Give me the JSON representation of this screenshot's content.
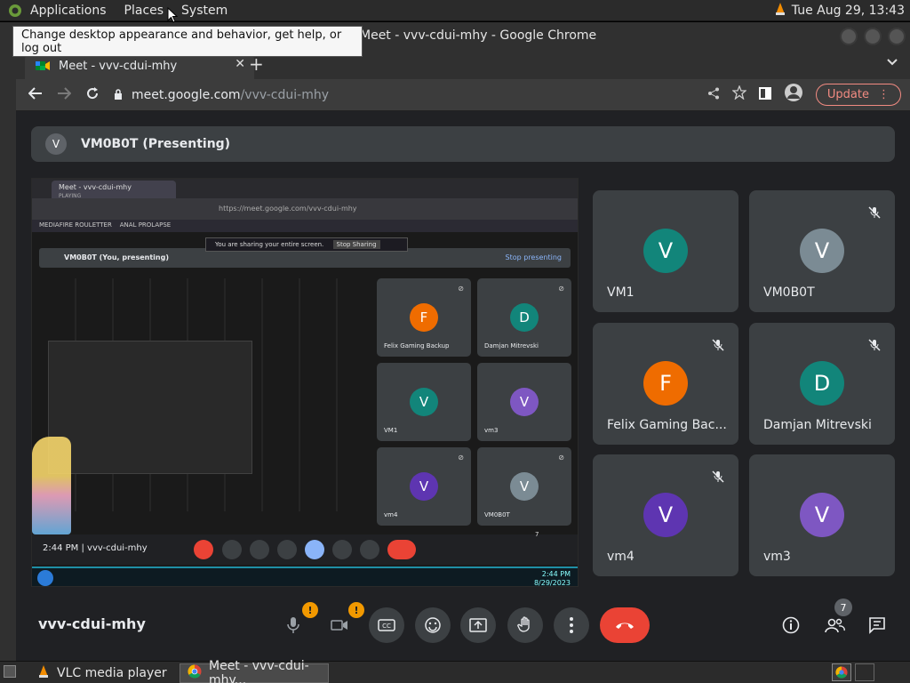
{
  "top_panel": {
    "menus": [
      "Applications",
      "Places",
      "System"
    ],
    "datetime": "Tue Aug 29, 13:43"
  },
  "tooltip": "Change desktop appearance and behavior, get help, or log out",
  "window": {
    "title": "Meet - vvv-cdui-mhy - Google Chrome"
  },
  "browser": {
    "tab_title": "Meet - vvv-cdui-mhy",
    "url_host": "meet.google.com",
    "url_path": "/vvv-cdui-mhy",
    "update_label": "Update"
  },
  "meet": {
    "presenting_initial": "V",
    "presenting_label": "VM0B0T (Presenting)",
    "meeting_code": "vvv-cdui-mhy",
    "people_count": "7",
    "mic_badge": "!",
    "cam_badge": "!",
    "participants": [
      {
        "initial": "V",
        "name": "VM1",
        "color": "#12857a",
        "muted": false
      },
      {
        "initial": "V",
        "name": "VM0B0T",
        "color": "#7b8b94",
        "muted": true
      },
      {
        "initial": "F",
        "name": "Felix Gaming Bac...",
        "color": "#ef6c00",
        "muted": true
      },
      {
        "initial": "D",
        "name": "Damjan Mitrevski",
        "color": "#12857a",
        "muted": true
      },
      {
        "initial": "V",
        "name": "vm4",
        "color": "#5e35b1",
        "muted": true
      },
      {
        "initial": "V",
        "name": "vm3",
        "color": "#7e57c2",
        "muted": false
      }
    ]
  },
  "screenshare": {
    "tab_title": "Meet - vvv-cdui-mhy",
    "tab_subtitle": "PLAYING",
    "url": "https://meet.google.com/vvv-cdui-mhy",
    "bookmark1": "MEDIAFIRE ROULETTER",
    "bookmark2": "ANAL PROLAPSE",
    "share_notice": "You are sharing your entire screen.",
    "stop_sharing": "Stop Sharing",
    "present_label": "VM0B0T (You, presenting)",
    "stop_presenting": "Stop presenting",
    "time_code": "2:44 PM  |  vvv-cdui-mhy",
    "tb_time": "2:44 PM",
    "tb_date": "8/29/2023",
    "tiles": [
      {
        "initial": "F",
        "name": "Felix Gaming Backup",
        "color": "#ef6c00"
      },
      {
        "initial": "D",
        "name": "Damjan Mitrevski",
        "color": "#12857a"
      },
      {
        "initial": "V",
        "name": "VM1",
        "color": "#12857a"
      },
      {
        "initial": "V",
        "name": "vm3",
        "color": "#7e57c2"
      },
      {
        "initial": "V",
        "name": "vm4",
        "color": "#5e35b1"
      },
      {
        "initial": "V",
        "name": "VM0B0T",
        "color": "#7b8b94"
      }
    ],
    "people_count": "7"
  },
  "taskbar": {
    "items": [
      "VLC media player",
      "Meet - vvv-cdui-mhy..."
    ]
  }
}
